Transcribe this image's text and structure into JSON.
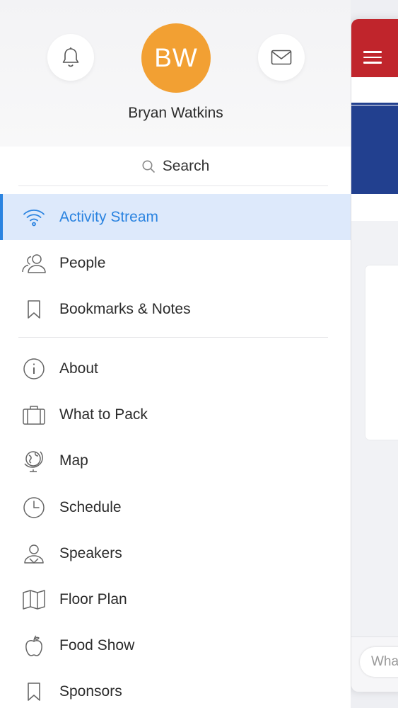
{
  "profile": {
    "avatar_initials": "BW",
    "avatar_color": "#f2a033",
    "user_name": "Bryan Watkins",
    "notifications_icon": "bell-icon",
    "messages_icon": "mail-icon"
  },
  "search": {
    "label": "Search",
    "icon": "search-icon"
  },
  "menu": {
    "primary": [
      {
        "label": "Activity Stream",
        "icon": "wifi-icon",
        "active": true
      },
      {
        "label": "People",
        "icon": "people-icon"
      },
      {
        "label": "Bookmarks & Notes",
        "icon": "bookmark-icon"
      }
    ],
    "secondary": [
      {
        "label": "About",
        "icon": "info-icon"
      },
      {
        "label": "What to Pack",
        "icon": "suitcase-icon"
      },
      {
        "label": "Map",
        "icon": "globe-icon"
      },
      {
        "label": "Schedule",
        "icon": "clock-icon"
      },
      {
        "label": "Speakers",
        "icon": "speaker-person-icon"
      },
      {
        "label": "Floor Plan",
        "icon": "map-fold-icon"
      },
      {
        "label": "Food Show",
        "icon": "apple-icon"
      },
      {
        "label": "Sponsors",
        "icon": "bookmark-icon"
      }
    ]
  },
  "background_app": {
    "menu_icon": "hamburger-icon",
    "input_placeholder": "Wha",
    "colors": {
      "topbar": "#c0252c",
      "banner": "#22408f",
      "active_accent": "#2a83e0"
    }
  }
}
